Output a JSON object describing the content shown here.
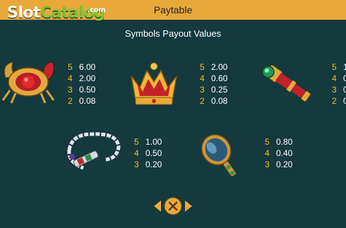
{
  "header": {
    "title": "Paytable",
    "logo_main": "Slot",
    "logo_accent": "Catalog",
    "logo_suffix": ".com"
  },
  "section_title": "Symbols Payout Values",
  "symbols": [
    {
      "icon": "red-gem-crab-icon",
      "payouts": [
        {
          "count": "5",
          "value": "6.00"
        },
        {
          "count": "4",
          "value": "2.00"
        },
        {
          "count": "3",
          "value": "0.50"
        },
        {
          "count": "2",
          "value": "0.08"
        }
      ]
    },
    {
      "icon": "gold-crown-icon",
      "payouts": [
        {
          "count": "5",
          "value": "2.00"
        },
        {
          "count": "4",
          "value": "0.60"
        },
        {
          "count": "3",
          "value": "0.25"
        },
        {
          "count": "2",
          "value": "0.08"
        }
      ]
    },
    {
      "icon": "spyglass-icon",
      "payouts": [
        {
          "count": "5",
          "value": "1"
        },
        {
          "count": "4",
          "value": "0"
        },
        {
          "count": "3",
          "value": "0"
        },
        {
          "count": "2",
          "value": "0"
        }
      ]
    },
    {
      "icon": "pearl-necklace-icon",
      "payouts": [
        {
          "count": "5",
          "value": "1.00"
        },
        {
          "count": "4",
          "value": "0.50"
        },
        {
          "count": "3",
          "value": "0.20"
        }
      ]
    },
    {
      "icon": "hand-mirror-icon",
      "payouts": [
        {
          "count": "5",
          "value": "0.80"
        },
        {
          "count": "4",
          "value": "0.40"
        },
        {
          "count": "3",
          "value": "0.20"
        }
      ]
    }
  ],
  "colors": {
    "background": "#143a3e",
    "header": "#e9a93a",
    "count": "#f2c618"
  },
  "close_icon": "close-icon"
}
